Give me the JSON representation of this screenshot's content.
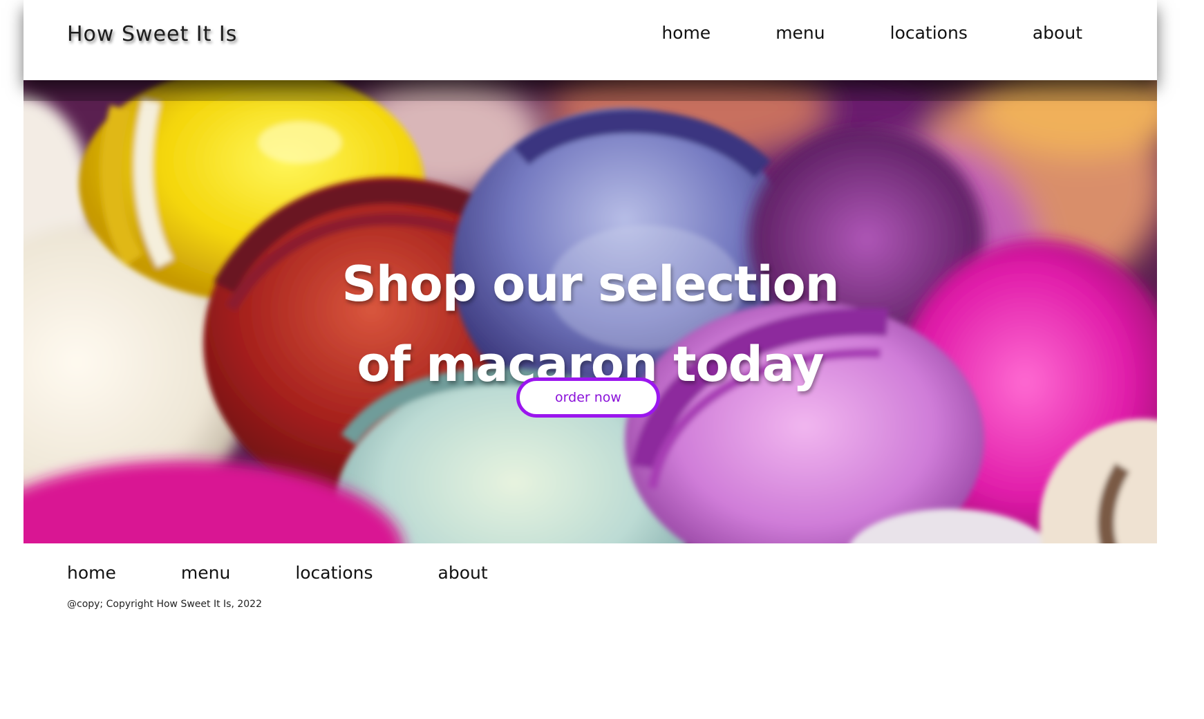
{
  "header": {
    "brand": "How Sweet It Is",
    "nav": [
      "home",
      "menu",
      "locations",
      "about"
    ]
  },
  "hero": {
    "title_line1": "Shop our selection",
    "title_line2": "of macaron today",
    "button_label": "order now",
    "accent_color": "#9b16ee"
  },
  "footer": {
    "nav": [
      "home",
      "menu",
      "locations",
      "about"
    ],
    "copyright": "@copy; Copyright How Sweet It Is, 2022"
  },
  "icons": []
}
